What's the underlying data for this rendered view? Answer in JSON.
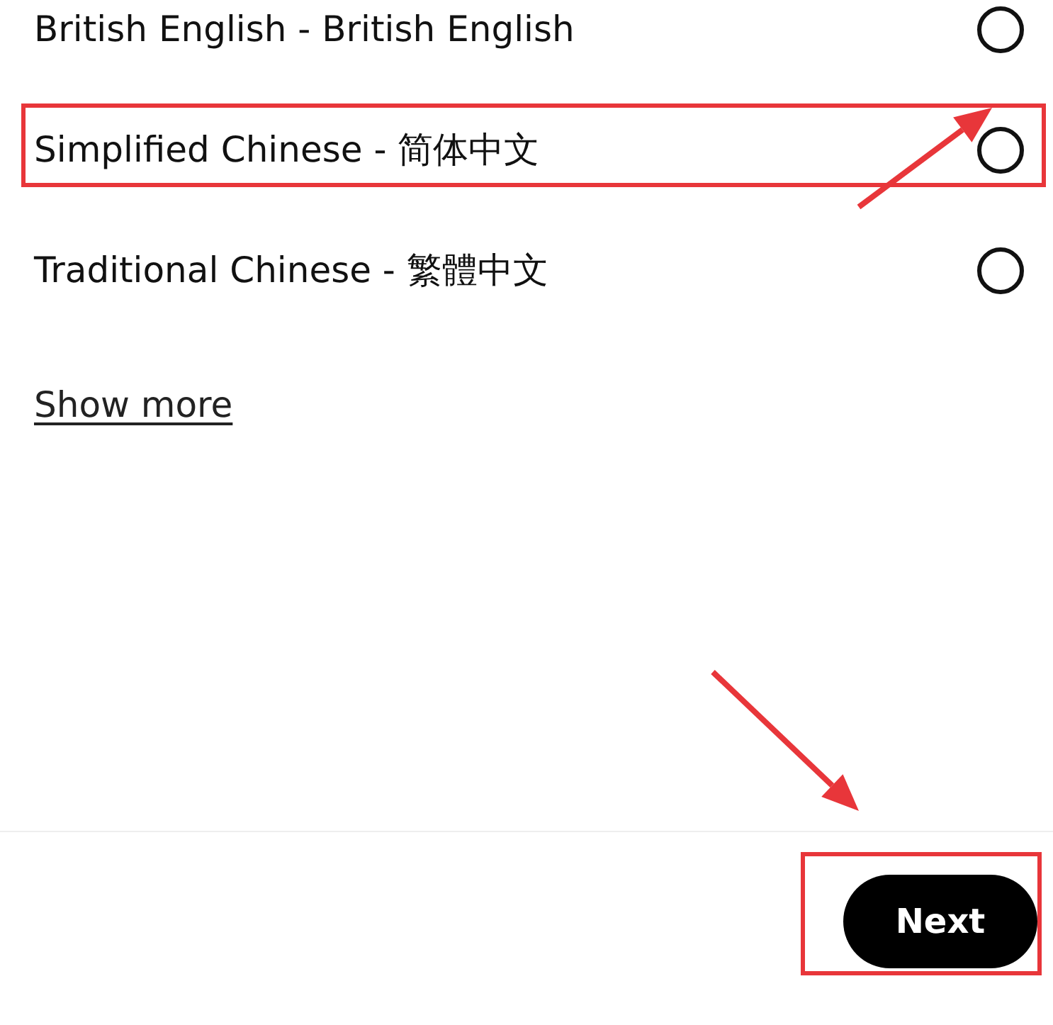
{
  "languages": [
    {
      "label": "British English - British English",
      "selected": false,
      "highlighted": false
    },
    {
      "label": "Simplified Chinese - 简体中文",
      "selected": false,
      "highlighted": true
    },
    {
      "label": "Traditional Chinese - 繁體中文",
      "selected": false,
      "highlighted": false
    }
  ],
  "show_more": "Show more",
  "next_button": {
    "label": "Next",
    "highlighted": true
  }
}
